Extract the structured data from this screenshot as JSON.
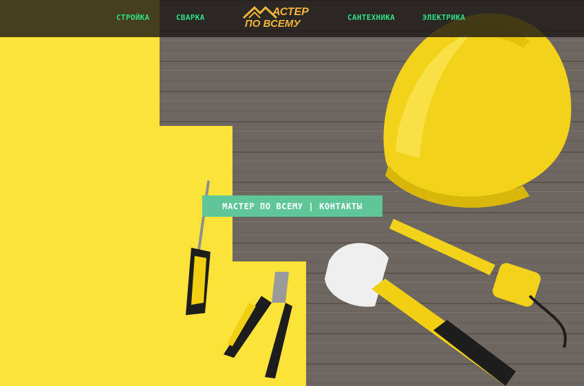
{
  "colors": {
    "nav_link": "#2fe08a",
    "accent_yellow": "#fbe33a",
    "cta_bg": "#5fc69a",
    "cta_text": "#ffffff",
    "wood": "#6e6661",
    "logo_orange": "#f2b43a"
  },
  "nav": {
    "left": [
      {
        "label": "СТРОЙКА"
      },
      {
        "label": "СВАРКА"
      }
    ],
    "right": [
      {
        "label": "САНТЕХНИКА"
      },
      {
        "label": "ЭЛЕКТРИКА"
      }
    ]
  },
  "logo": {
    "line1": "АСТЕР",
    "line2": "ПО ВСЕМУ",
    "icon": "roof-m-logo-icon"
  },
  "hero": {
    "cta_label": "МАСТЕР ПО ВСЕМУ | КОНТАКТЫ",
    "icons": [
      "hard-hat-icon",
      "screwdriver-icon",
      "pliers-icon",
      "hammer-icon",
      "tape-measure-icon"
    ]
  }
}
